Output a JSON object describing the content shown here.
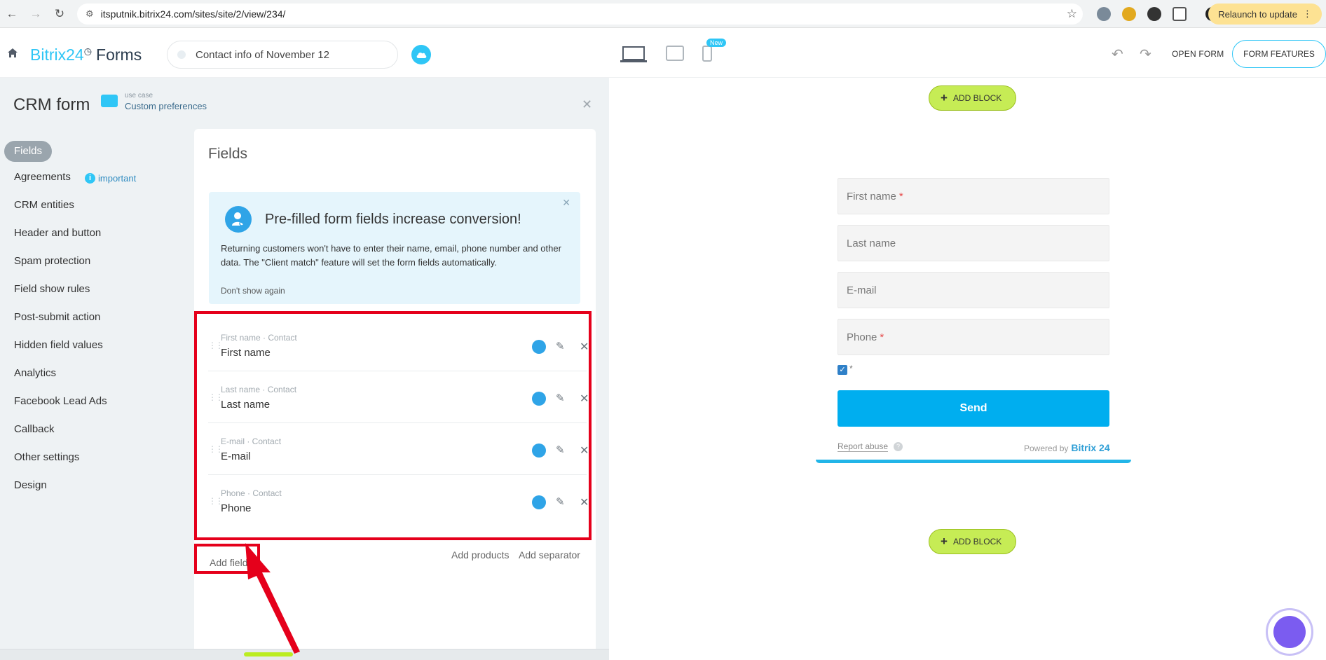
{
  "browser": {
    "url": "itsputnik.bitrix24.com/sites/site/2/view/234/",
    "relaunch_label": "Relaunch to update"
  },
  "header": {
    "logo_brand": "Bitrix24",
    "logo_product": "Forms",
    "form_name": "Contact info of November 12",
    "new_badge": "New",
    "open_form": "OPEN FORM",
    "form_features": "FORM FEATURES"
  },
  "panel": {
    "title": "CRM form",
    "usecase_label": "use case",
    "usecase_value": "Custom preferences",
    "menu": [
      {
        "label": "Fields",
        "active": true
      },
      {
        "label": "Agreements",
        "badge": "important"
      },
      {
        "label": "CRM entities"
      },
      {
        "label": "Header and button"
      },
      {
        "label": "Spam protection"
      },
      {
        "label": "Field show rules"
      },
      {
        "label": "Post-submit action"
      },
      {
        "label": "Hidden field values"
      },
      {
        "label": "Analytics"
      },
      {
        "label": "Facebook Lead Ads"
      },
      {
        "label": "Callback"
      },
      {
        "label": "Other settings"
      },
      {
        "label": "Design"
      }
    ]
  },
  "fields_card": {
    "title": "Fields",
    "promo": {
      "title": "Pre-filled form fields increase conversion!",
      "text": "Returning customers won't have to enter their name, email, phone number and other data. The \"Client match\" feature will set the form fields automatically.",
      "dismiss": "Don't show again"
    },
    "fields": [
      {
        "sub": "First name · Contact",
        "name": "First name"
      },
      {
        "sub": "Last name · Contact",
        "name": "Last name"
      },
      {
        "sub": "E-mail · Contact",
        "name": "E-mail"
      },
      {
        "sub": "Phone · Contact",
        "name": "Phone"
      }
    ],
    "add_field": "Add field",
    "add_products": "Add products",
    "add_separator": "Add separator"
  },
  "preview": {
    "add_block": "ADD BLOCK",
    "inputs": [
      {
        "placeholder": "First name",
        "required": "*"
      },
      {
        "placeholder": "Last name",
        "required": ""
      },
      {
        "placeholder": "E-mail",
        "required": ""
      },
      {
        "placeholder": "Phone",
        "required": "*"
      }
    ],
    "checkbox_star": "*",
    "send": "Send",
    "report_abuse": "Report abuse",
    "help_mark": "?",
    "powered_by": "Powered by",
    "powered_brand": "Bitrix 24"
  },
  "colors": {
    "accent": "#2fc6f6",
    "send": "#00aeef",
    "add_block": "#c6ec55",
    "highlight": "#e5001b"
  }
}
